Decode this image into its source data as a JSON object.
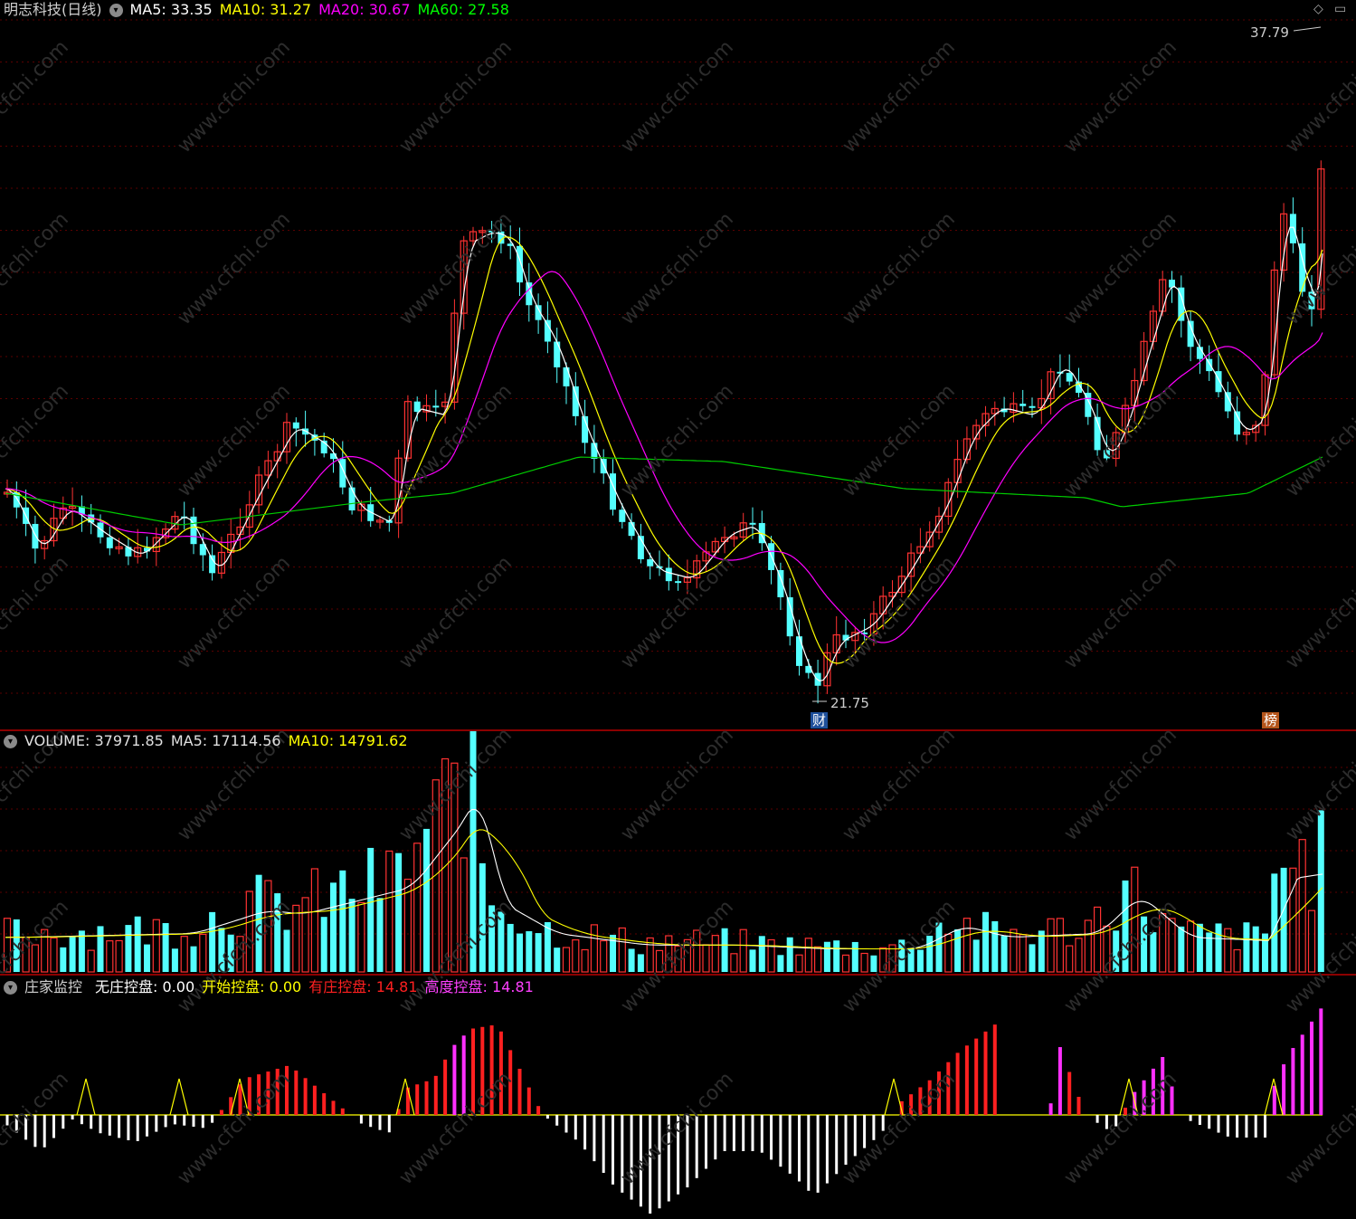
{
  "price_panel": {
    "title": "明志科技(日线)",
    "ma5": "MA5: 33.35",
    "ma10": "MA10: 31.27",
    "ma20": "MA20: 30.67",
    "ma60": "MA60: 27.58",
    "high_label": "37.79",
    "low_label": "21.75",
    "event_tag_1": "财",
    "event_tag_2": "榜",
    "colors": {
      "ma5": "#ffffff",
      "ma10": "#ffff00",
      "ma20": "#ff00ff",
      "ma60": "#00cc00",
      "up": "#ff3232",
      "down": "#54ffff"
    }
  },
  "volume_panel": {
    "volume": "VOLUME: 37971.85",
    "ma5": "MA5: 17114.56",
    "ma10": "MA10: 14791.62"
  },
  "indicator_panel": {
    "name": "庄家监控",
    "none": "无庄控盘: 0.00",
    "start": "开始控盘: 0.00",
    "has": "有庄控盘: 14.81",
    "high": "高度控盘: 14.81"
  },
  "watermark": "www.cfchi.com",
  "icons": {
    "collapse": "chevron-down-icon",
    "window": "diamond-icon"
  }
}
